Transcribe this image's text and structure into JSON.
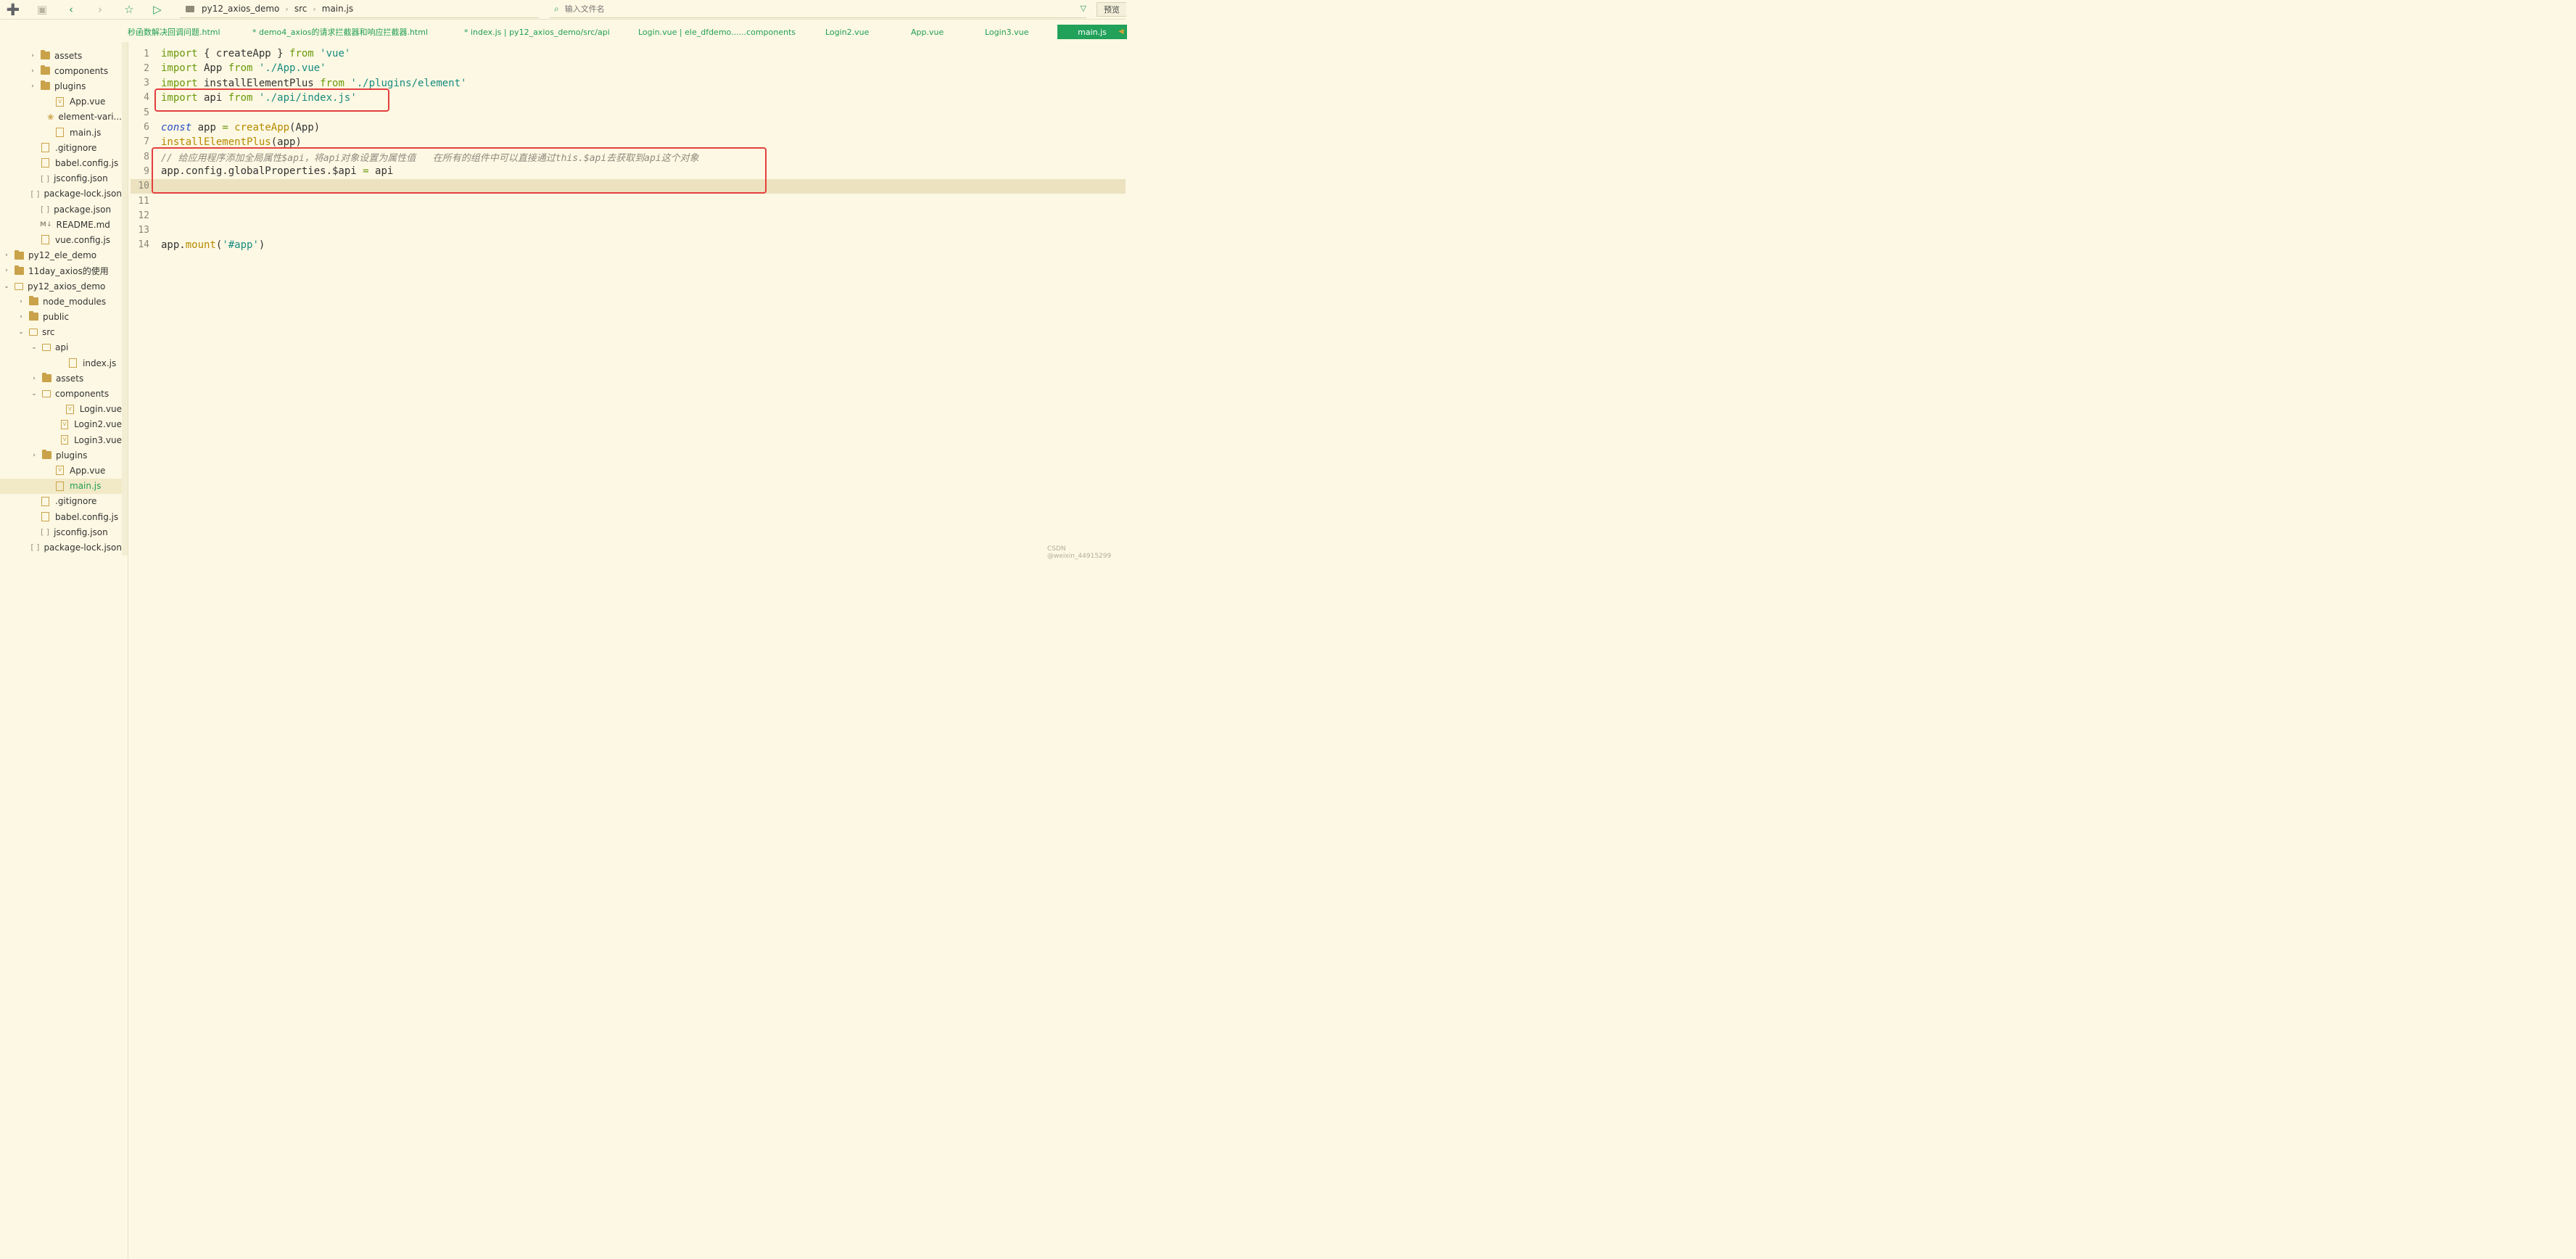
{
  "toolbar": {
    "icons": [
      "new-file-icon",
      "save-icon",
      "back-icon",
      "forward-icon",
      "star-icon",
      "run-icon"
    ]
  },
  "breadcrumb": [
    "py12_axios_demo",
    "src",
    "main.js"
  ],
  "search": {
    "placeholder": "输入文件名"
  },
  "preview_label": "预览",
  "tabs": [
    "秒函数解决回调问题.html",
    "* demo4_axios的请求拦截器和响应拦截器.html",
    "* index.js | py12_axios_demo/src/api",
    "Login.vue | ele_dfdemo......components",
    "Login2.vue",
    "App.vue",
    "Login3.vue",
    "main.js"
  ],
  "sidebar": {
    "items": [
      {
        "label": "assets",
        "type": "folder",
        "expanded": false
      },
      {
        "label": "components",
        "type": "folder",
        "expanded": false
      },
      {
        "label": "plugins",
        "type": "folder",
        "expanded": false
      },
      {
        "label": "App.vue",
        "type": "vue"
      },
      {
        "label": "element-vari...",
        "type": "style"
      },
      {
        "label": "main.js",
        "type": "file"
      },
      {
        "label": ".gitignore",
        "type": "file"
      },
      {
        "label": "babel.config.js",
        "type": "file"
      },
      {
        "label": "jsconfig.json",
        "type": "json"
      },
      {
        "label": "package-lock.json",
        "type": "json"
      },
      {
        "label": "package.json",
        "type": "json"
      },
      {
        "label": "README.md",
        "type": "md"
      },
      {
        "label": "vue.config.js",
        "type": "file"
      },
      {
        "label": "py12_ele_demo",
        "type": "folder",
        "expanded": false
      },
      {
        "label": "11day_axios的使用",
        "type": "folder",
        "expanded": false
      },
      {
        "label": "py12_axios_demo",
        "type": "folder",
        "expanded": true
      },
      {
        "label": "node_modules",
        "type": "folder",
        "expanded": false
      },
      {
        "label": "public",
        "type": "folder",
        "expanded": false
      },
      {
        "label": "src",
        "type": "folder",
        "expanded": true
      },
      {
        "label": "api",
        "type": "folder",
        "expanded": true
      },
      {
        "label": "index.js",
        "type": "file"
      },
      {
        "label": "assets",
        "type": "folder",
        "expanded": false
      },
      {
        "label": "components",
        "type": "folder",
        "expanded": true
      },
      {
        "label": "Login.vue",
        "type": "vue"
      },
      {
        "label": "Login2.vue",
        "type": "vue"
      },
      {
        "label": "Login3.vue",
        "type": "vue"
      },
      {
        "label": "plugins",
        "type": "folder",
        "expanded": false
      },
      {
        "label": "App.vue",
        "type": "vue"
      },
      {
        "label": "main.js",
        "type": "file",
        "active": true
      },
      {
        "label": ".gitignore",
        "type": "file"
      },
      {
        "label": "babel.config.js",
        "type": "file"
      },
      {
        "label": "jsconfig.json",
        "type": "json"
      },
      {
        "label": "package-lock.json",
        "type": "json"
      }
    ]
  },
  "editor": {
    "current_line": 10,
    "lines": [
      {
        "n": "1",
        "tokens": [
          [
            "kw",
            "import"
          ],
          [
            "code",
            " { createApp } "
          ],
          [
            "kw",
            "from"
          ],
          [
            "code",
            " "
          ],
          [
            "str",
            "'vue'"
          ]
        ]
      },
      {
        "n": "2",
        "tokens": [
          [
            "kw",
            "import"
          ],
          [
            "code",
            " App "
          ],
          [
            "kw",
            "from"
          ],
          [
            "code",
            " "
          ],
          [
            "str",
            "'./App.vue'"
          ]
        ]
      },
      {
        "n": "3",
        "tokens": [
          [
            "kw",
            "import"
          ],
          [
            "code",
            " installElementPlus "
          ],
          [
            "kw",
            "from"
          ],
          [
            "code",
            " "
          ],
          [
            "str",
            "'./plugins/element'"
          ]
        ]
      },
      {
        "n": "4",
        "tokens": [
          [
            "kw",
            "import"
          ],
          [
            "code",
            " api "
          ],
          [
            "kw",
            "from"
          ],
          [
            "code",
            " "
          ],
          [
            "str",
            "'./api/index.js'"
          ]
        ]
      },
      {
        "n": "5",
        "tokens": []
      },
      {
        "n": "6",
        "tokens": [
          [
            "const",
            "const"
          ],
          [
            "code",
            " app "
          ],
          [
            "kw",
            "="
          ],
          [
            "code",
            " "
          ],
          [
            "fn",
            "createApp"
          ],
          [
            "code",
            "(App)"
          ]
        ]
      },
      {
        "n": "7",
        "tokens": [
          [
            "fn",
            "installElementPlus"
          ],
          [
            "code",
            "(app)"
          ]
        ]
      },
      {
        "n": "8",
        "tokens": [
          [
            "cmt",
            "// 给应用程序添加全局属性$api，将api对象设置为属性值   在所有的组件中可以直接通过this.$api去获取到api这个对象"
          ]
        ]
      },
      {
        "n": "9",
        "tokens": [
          [
            "code",
            "app.config.globalProperties.$api "
          ],
          [
            "kw",
            "="
          ],
          [
            "code",
            " api"
          ]
        ]
      },
      {
        "n": "10",
        "tokens": []
      },
      {
        "n": "11",
        "tokens": []
      },
      {
        "n": "12",
        "tokens": []
      },
      {
        "n": "13",
        "tokens": []
      },
      {
        "n": "14",
        "tokens": [
          [
            "code",
            "app."
          ],
          [
            "fn",
            "mount"
          ],
          [
            "code",
            "("
          ],
          [
            "str",
            "'#app'"
          ],
          [
            "code",
            ")"
          ]
        ]
      }
    ]
  },
  "watermark": "CSDN @weixin_44915299",
  "colors": {
    "background": "#fdf8e3",
    "accent": "#21a15a",
    "highlight_box": "#e2403e",
    "keyword": "#6a9a0a",
    "string": "#168a7f",
    "function": "#b58900",
    "comment": "#8c8a7f"
  }
}
